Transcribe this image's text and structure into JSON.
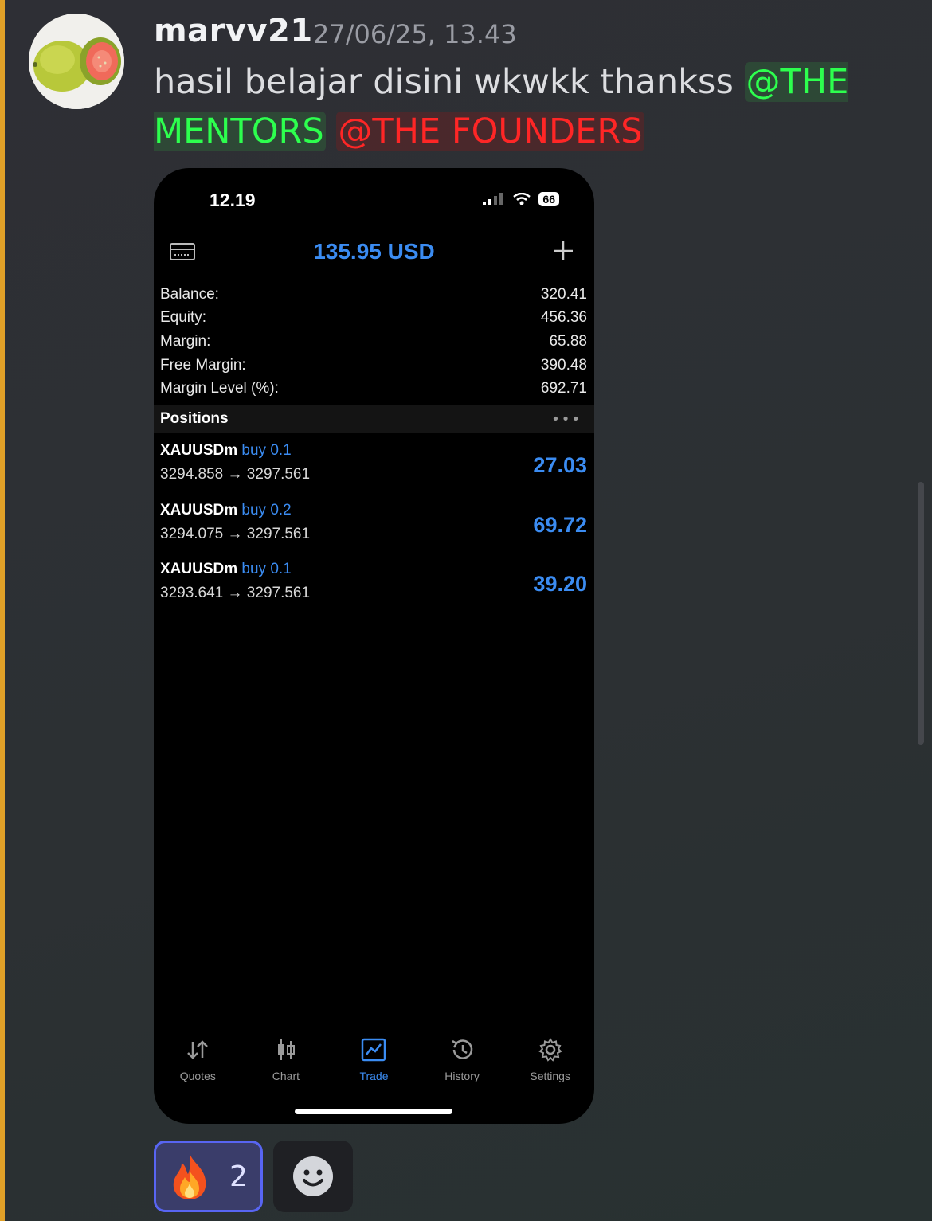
{
  "message": {
    "username": "marvv21",
    "timestamp": "27/06/25, 13.43",
    "text": "hasil belajar disini wkwkk thankss",
    "mentions": [
      {
        "label": "@THE MENTORS",
        "color": "#2dff4e"
      },
      {
        "label": "@THE FOUNDERS",
        "color": "#ff2626"
      }
    ],
    "avatar_icon": "guava-fruit-avatar",
    "accent_color": "#e0a028"
  },
  "phone": {
    "status_time": "12.19",
    "battery": "66",
    "header_balance": "135.95 USD",
    "account": [
      {
        "label": "Balance:",
        "value": "320.41"
      },
      {
        "label": "Equity:",
        "value": "456.36"
      },
      {
        "label": "Margin:",
        "value": "65.88"
      },
      {
        "label": "Free Margin:",
        "value": "390.48"
      },
      {
        "label": "Margin Level (%):",
        "value": "692.71"
      }
    ],
    "positions_title": "Positions",
    "positions_more": "•••",
    "positions": [
      {
        "symbol": "XAUUSDm",
        "direction": "buy 0.1",
        "prices": "3294.858 → 3297.561",
        "profit": "27.03"
      },
      {
        "symbol": "XAUUSDm",
        "direction": "buy 0.2",
        "prices": "3294.075 → 3297.561",
        "profit": "69.72"
      },
      {
        "symbol": "XAUUSDm",
        "direction": "buy 0.1",
        "prices": "3293.641 → 3297.561",
        "profit": "39.20"
      }
    ],
    "tabs": [
      {
        "label": "Quotes",
        "icon": "quotes-arrows-icon",
        "active": false
      },
      {
        "label": "Chart",
        "icon": "candlestick-icon",
        "active": false
      },
      {
        "label": "Trade",
        "icon": "trade-chart-icon",
        "active": true
      },
      {
        "label": "History",
        "icon": "history-clock-icon",
        "active": false
      },
      {
        "label": "Settings",
        "icon": "gear-icon",
        "active": false
      }
    ],
    "accent_color": "#3b8cf2"
  },
  "reactions": [
    {
      "emoji": "🔥",
      "count": "2"
    }
  ]
}
